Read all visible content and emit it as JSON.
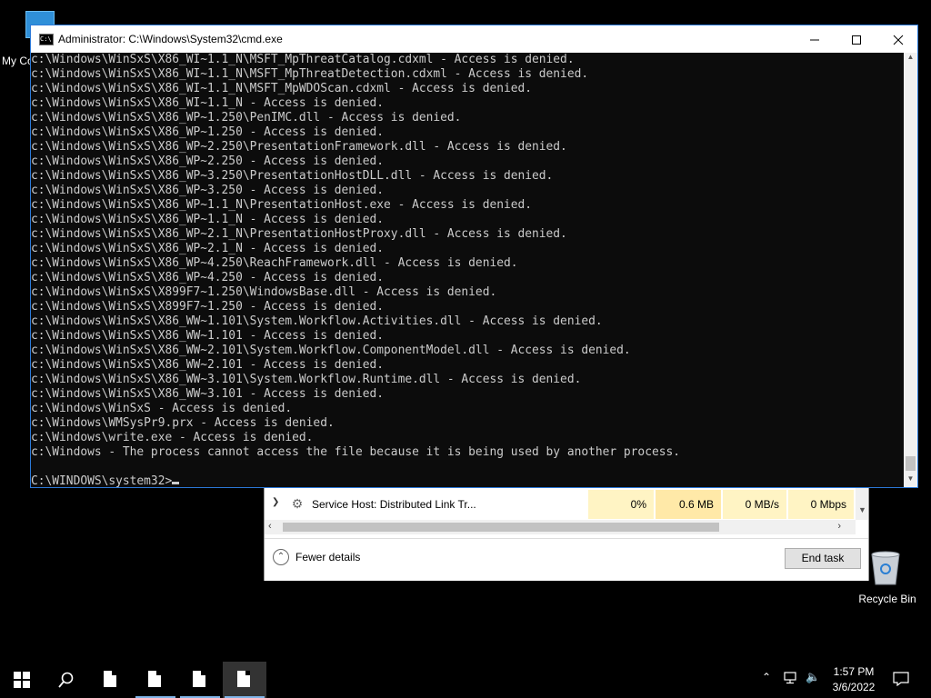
{
  "desktop": {
    "my_computer_label": "My Co",
    "recycle_bin_label": "Recycle Bin"
  },
  "task_manager": {
    "row": {
      "name": "Service Host: Distributed Link Tr...",
      "cpu": "0%",
      "memory": "0.6 MB",
      "disk": "0 MB/s",
      "network": "0 Mbps"
    },
    "fewer_details_label": "Fewer details",
    "end_task_label": "End task"
  },
  "cmd": {
    "title": "Administrator: C:\\Windows\\System32\\cmd.exe",
    "icon_text": "C:\\",
    "lines": [
      "c:\\Windows\\WinSxS\\X86_WI~1.1_N\\MSFT_MpThreatCatalog.cdxml - Access is denied.",
      "c:\\Windows\\WinSxS\\X86_WI~1.1_N\\MSFT_MpThreatDetection.cdxml - Access is denied.",
      "c:\\Windows\\WinSxS\\X86_WI~1.1_N\\MSFT_MpWDOScan.cdxml - Access is denied.",
      "c:\\Windows\\WinSxS\\X86_WI~1.1_N - Access is denied.",
      "c:\\Windows\\WinSxS\\X86_WP~1.250\\PenIMC.dll - Access is denied.",
      "c:\\Windows\\WinSxS\\X86_WP~1.250 - Access is denied.",
      "c:\\Windows\\WinSxS\\X86_WP~2.250\\PresentationFramework.dll - Access is denied.",
      "c:\\Windows\\WinSxS\\X86_WP~2.250 - Access is denied.",
      "c:\\Windows\\WinSxS\\X86_WP~3.250\\PresentationHostDLL.dll - Access is denied.",
      "c:\\Windows\\WinSxS\\X86_WP~3.250 - Access is denied.",
      "c:\\Windows\\WinSxS\\X86_WP~1.1_N\\PresentationHost.exe - Access is denied.",
      "c:\\Windows\\WinSxS\\X86_WP~1.1_N - Access is denied.",
      "c:\\Windows\\WinSxS\\X86_WP~2.1_N\\PresentationHostProxy.dll - Access is denied.",
      "c:\\Windows\\WinSxS\\X86_WP~2.1_N - Access is denied.",
      "c:\\Windows\\WinSxS\\X86_WP~4.250\\ReachFramework.dll - Access is denied.",
      "c:\\Windows\\WinSxS\\X86_WP~4.250 - Access is denied.",
      "c:\\Windows\\WinSxS\\X899F7~1.250\\WindowsBase.dll - Access is denied.",
      "c:\\Windows\\WinSxS\\X899F7~1.250 - Access is denied.",
      "c:\\Windows\\WinSxS\\X86_WW~1.101\\System.Workflow.Activities.dll - Access is denied.",
      "c:\\Windows\\WinSxS\\X86_WW~1.101 - Access is denied.",
      "c:\\Windows\\WinSxS\\X86_WW~2.101\\System.Workflow.ComponentModel.dll - Access is denied.",
      "c:\\Windows\\WinSxS\\X86_WW~2.101 - Access is denied.",
      "c:\\Windows\\WinSxS\\X86_WW~3.101\\System.Workflow.Runtime.dll - Access is denied.",
      "c:\\Windows\\WinSxS\\X86_WW~3.101 - Access is denied.",
      "c:\\Windows\\WinSxS - Access is denied.",
      "c:\\Windows\\WMSysPr9.prx - Access is denied.",
      "c:\\Windows\\write.exe - Access is denied.",
      "c:\\Windows - The process cannot access the file because it is being used by another process."
    ],
    "prompt": "C:\\WINDOWS\\system32>"
  },
  "taskbar": {
    "time": "1:57 PM",
    "date": "3/6/2022"
  }
}
